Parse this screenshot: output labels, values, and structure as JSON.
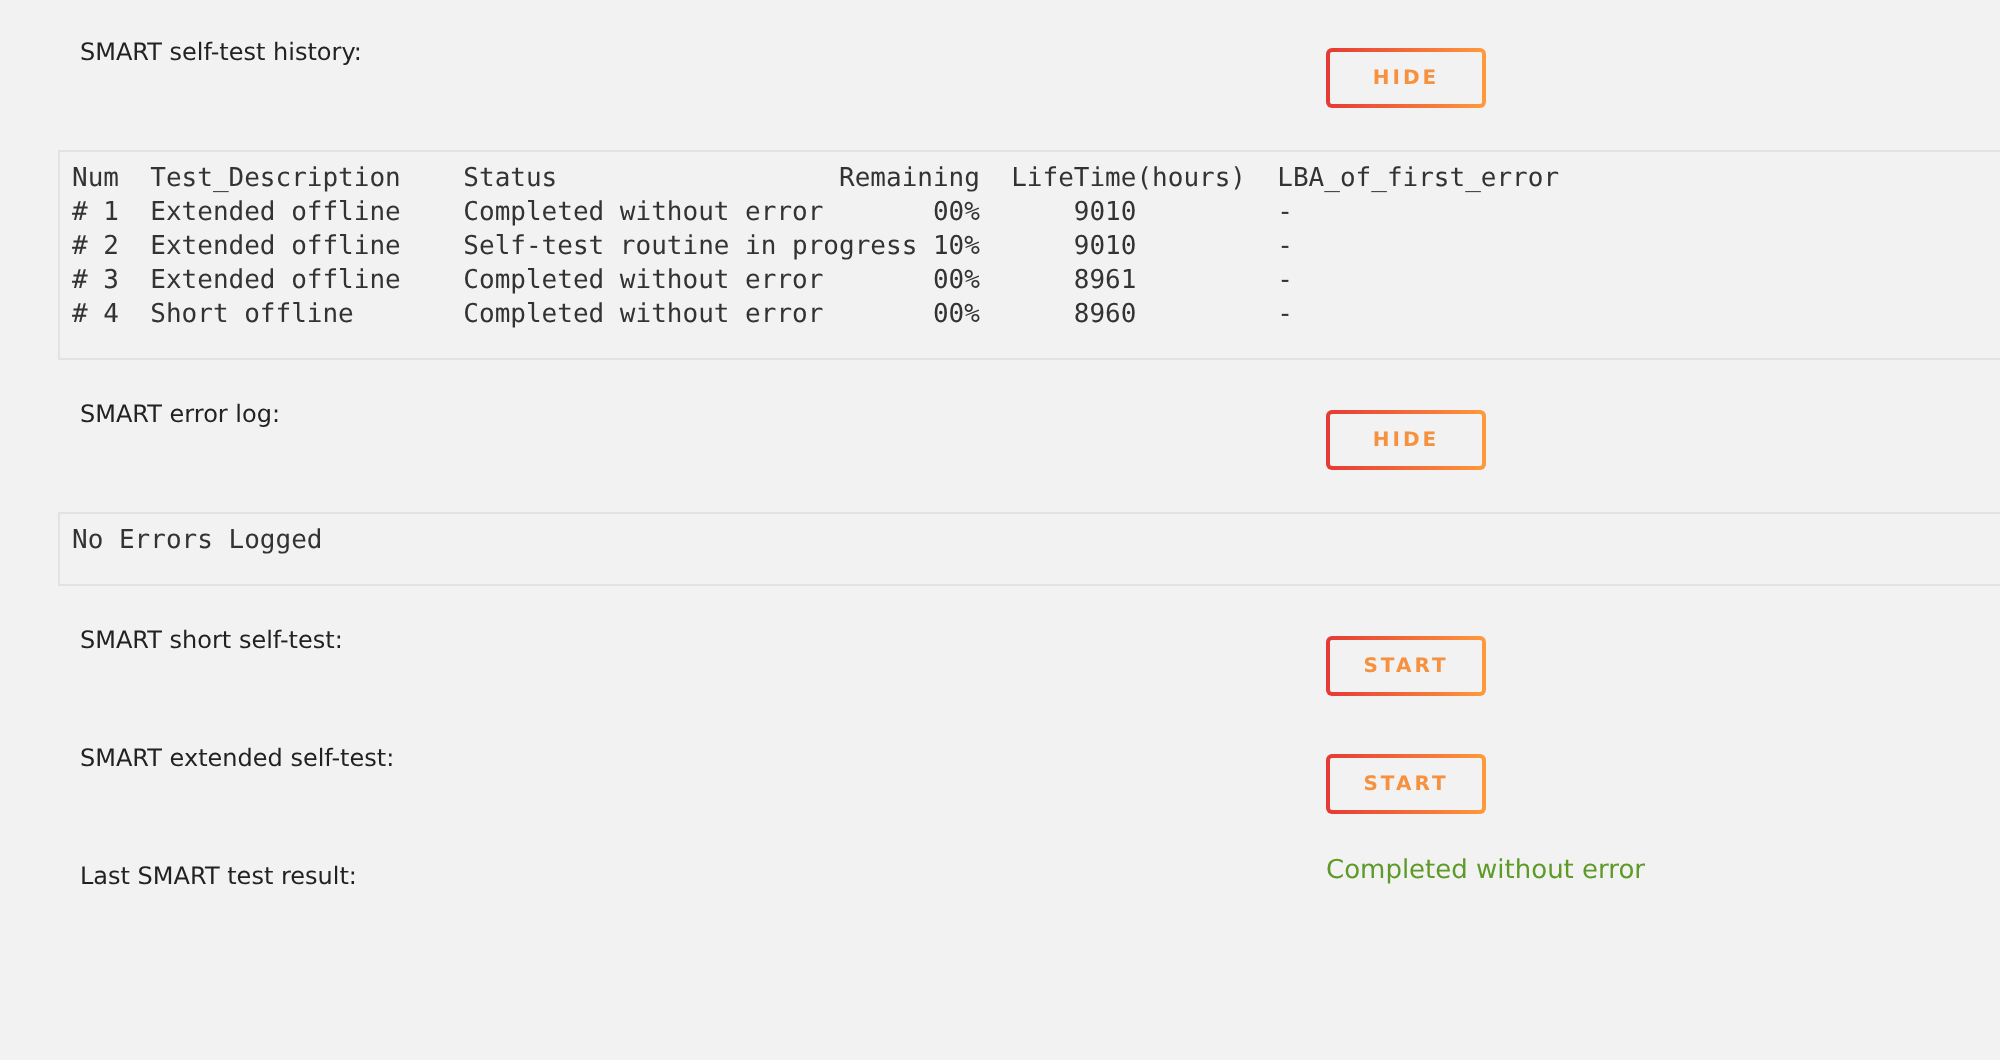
{
  "sections": [
    {
      "kind": "button",
      "label": "SMART self-test history:",
      "button": "HIDE"
    },
    {
      "kind": "log",
      "lines": [
        "Num  Test_Description    Status                  Remaining  LifeTime(hours)  LBA_of_first_error",
        "# 1  Extended offline    Completed without error       00%      9010         -",
        "# 2  Extended offline    Self-test routine in progress 10%      9010         -",
        "# 3  Extended offline    Completed without error       00%      8961         -",
        "# 4  Short offline       Completed without error       00%      8960         -"
      ]
    },
    {
      "kind": "button",
      "label": "SMART error log:",
      "button": "HIDE"
    },
    {
      "kind": "log",
      "lines": [
        "No Errors Logged"
      ]
    },
    {
      "kind": "button",
      "label": "SMART short self-test:",
      "button": "START"
    },
    {
      "kind": "button",
      "label": "SMART extended self-test:",
      "button": "START"
    },
    {
      "kind": "result",
      "label": "Last SMART test result:",
      "value": "Completed without error"
    }
  ]
}
